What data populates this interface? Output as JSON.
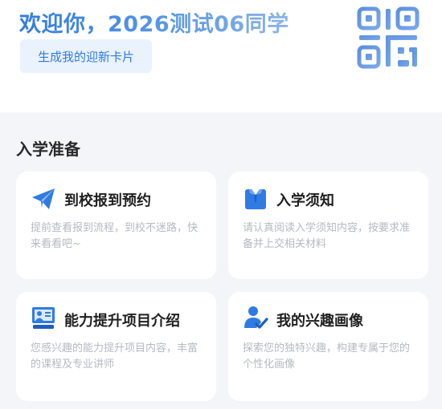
{
  "header": {
    "welcome": "欢迎你，2026测试06同学",
    "card_button_label": "生成我的迎新卡片",
    "qr_icon": "qr-code-icon",
    "accent_color": "#2f7be4"
  },
  "section": {
    "title": "入学准备"
  },
  "tiles": [
    {
      "icon": "paper-plane-icon",
      "title": "到校报到预约",
      "desc": "提前查看报到流程，到校不迷路，快来看看吧~"
    },
    {
      "icon": "shirt-icon",
      "title": "入学须知",
      "desc": "请认真阅读入学须知内容，按要求准备并上交相关材料"
    },
    {
      "icon": "presentation-icon",
      "title": "能力提升项目介绍",
      "desc": "您感兴趣的能力提升项目内容，丰富的课程及专业讲师"
    },
    {
      "icon": "user-check-icon",
      "title": "我的兴趣画像",
      "desc": "探索您的独特兴趣，构建专属于您的个性化画像"
    }
  ]
}
